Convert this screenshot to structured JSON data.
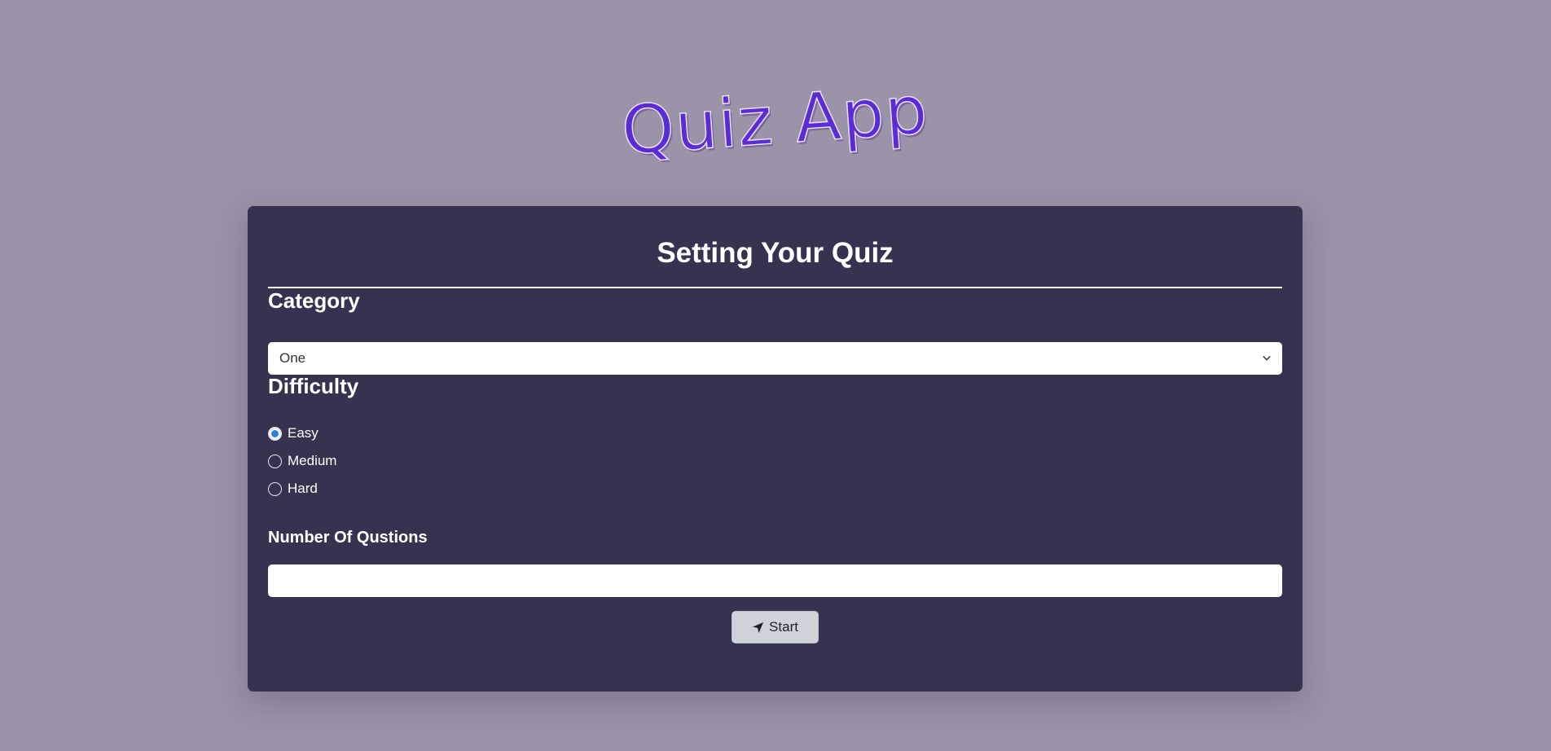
{
  "app": {
    "title": "Quiz App"
  },
  "panel": {
    "title": "Setting Your Quiz"
  },
  "category": {
    "label": "Category",
    "selected": "One",
    "icon": "chevron-down-icon"
  },
  "difficulty": {
    "label": "Difficulty",
    "options": [
      {
        "label": "Easy",
        "checked": true
      },
      {
        "label": "Medium",
        "checked": false
      },
      {
        "label": "Hard",
        "checked": false
      }
    ]
  },
  "questions": {
    "label": "Number Of Qustions",
    "value": "",
    "placeholder": ""
  },
  "start": {
    "label": "Start",
    "icon": "send-icon"
  },
  "colors": {
    "background": "#9b93a8",
    "panel": "#363250",
    "title_accent": "#5b2bd6",
    "radio_checked": "#2f7fd6",
    "button": "#cfd2d8"
  }
}
